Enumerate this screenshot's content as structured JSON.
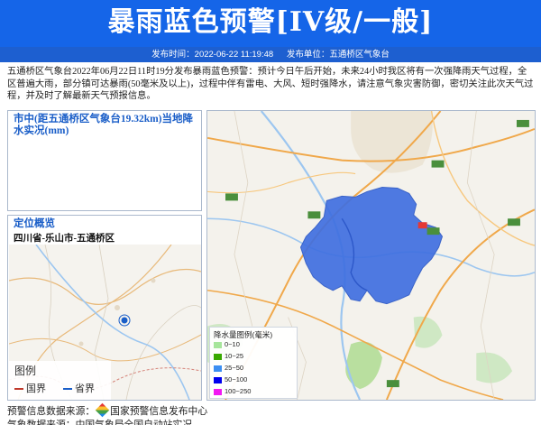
{
  "header": {
    "title": "暴雨蓝色预警[IV级/一般]",
    "publish_time_label": "发布时间：2022-06-22 11:19:48",
    "publisher_label": "发布单位：五通桥区气象台"
  },
  "alert": {
    "body": "五通桥区气象台2022年06月22日11时19分发布暴雨蓝色预警：预计今日午后开始，未来24小时我区将有一次强降雨天气过程，全区普遍大雨，部分镇可达暴雨(50毫米及以上)，过程中伴有雷电、大风、短时强降水，请注意气象灾害防御，密切关注此次天气过程，并及时了解最新天气预报信息。"
  },
  "rain_panel": {
    "title": "市中(距五通桥区气象台19.32km)当地降水实况(mm)"
  },
  "location_panel": {
    "title": "定位概览",
    "location": "四川省-乐山市-五通桥区",
    "legend_title": "图例",
    "legend_items": [
      {
        "label": "国界",
        "color": "#c0392b"
      },
      {
        "label": "省界",
        "color": "#1a5ec8"
      }
    ]
  },
  "rain_legend": {
    "title": "降水量图例(毫米)",
    "items": [
      {
        "label": "0~10",
        "color": "#a6e59b"
      },
      {
        "label": "10~25",
        "color": "#38a800"
      },
      {
        "label": "25~50",
        "color": "#3b8ef2"
      },
      {
        "label": "50~100",
        "color": "#0000ee"
      },
      {
        "label": "100~250",
        "color": "#f218f2"
      }
    ]
  },
  "footer": {
    "source_prefix": "预警信息数据来源：",
    "source_name": "国家预警信息发布中心",
    "line2": "气象数据来源：中国气象局全国自动站实况"
  },
  "colors": {
    "banner": "#1565e8",
    "alert_area": "#3f6fe0"
  }
}
